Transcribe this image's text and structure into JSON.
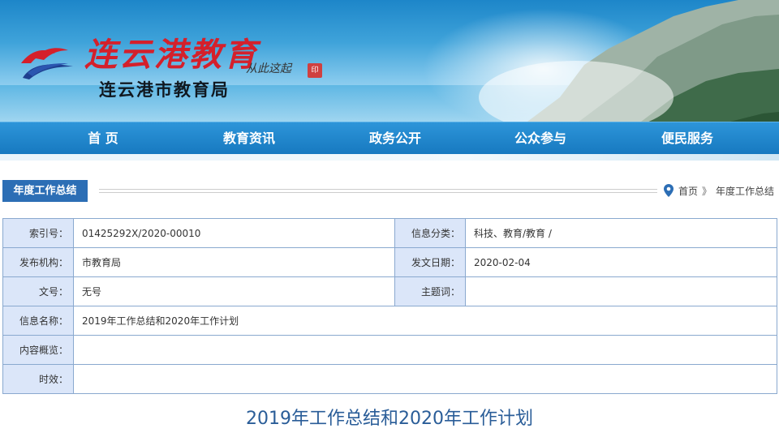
{
  "header": {
    "logo_title": "连云港教育",
    "logo_subtitle": "连云港市教育局",
    "slogan": "从此这起",
    "seal_text": "印",
    "logo_icon": "wave-bird-logo-icon"
  },
  "nav": {
    "items": [
      {
        "label": "首 页"
      },
      {
        "label": "教育资讯"
      },
      {
        "label": "政务公开"
      },
      {
        "label": "公众参与"
      },
      {
        "label": "便民服务"
      }
    ]
  },
  "section": {
    "tab_label": "年度工作总结",
    "breadcrumb": {
      "icon": "location-pin-icon",
      "home": "首页",
      "separator": "》",
      "current": "年度工作总结"
    }
  },
  "info": {
    "index_label": "索引号：",
    "index_value": "01425292X/2020-00010",
    "category_label": "信息分类：",
    "category_value": "科技、教育/教育 /",
    "publisher_label": "发布机构：",
    "publisher_value": "市教育局",
    "date_label": "发文日期：",
    "date_value": "2020-02-04",
    "docno_label": "文号：",
    "docno_value": "无号",
    "subject_label": "主题词：",
    "subject_value": "",
    "name_label": "信息名称：",
    "name_value": "2019年工作总结和2020年工作计划",
    "summary_label": "内容概览：",
    "summary_value": "",
    "validity_label": "时效：",
    "validity_value": ""
  },
  "article": {
    "title": "2019年工作总结和2020年工作计划"
  },
  "colors": {
    "nav_bg": "#1779c0",
    "tab_bg": "#2c6eb5",
    "label_bg": "#dbe6f9",
    "border": "#8aa9cf",
    "title_color": "#2a5d98",
    "logo_red": "#d4202b"
  }
}
